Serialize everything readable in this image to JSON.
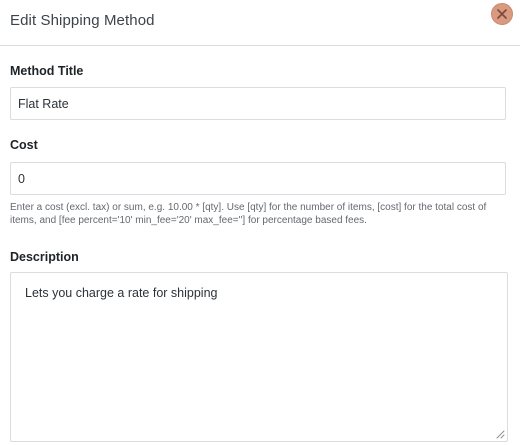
{
  "modal": {
    "title": "Edit Shipping Method",
    "close_icon": "close-icon"
  },
  "method_title": {
    "label": "Method Title",
    "value": "Flat Rate"
  },
  "cost": {
    "label": "Cost",
    "value": "0",
    "help_text": "Enter a cost (excl. tax) or sum, e.g. 10.00 * [qty]. Use [qty] for the number of items, [cost] for the total cost of items, and [fee percent='10' min_fee='20' max_fee=''] for percentage based fees."
  },
  "description": {
    "label": "Description",
    "value": "Lets you charge a rate for shipping"
  },
  "colors": {
    "close_button": "#d99a80",
    "border": "#dcdcde",
    "help_text": "#646970"
  }
}
